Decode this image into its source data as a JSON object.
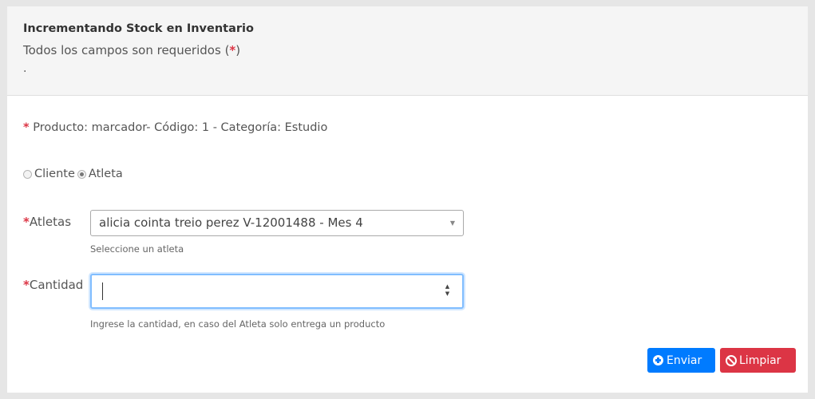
{
  "header": {
    "title": "Incrementando Stock en Inventario",
    "subtitle": "Todos los campos son requeridos",
    "subtitle_open": "(",
    "subtitle_star": "*",
    "subtitle_close": ")",
    "dot": "."
  },
  "product": {
    "star": "*",
    "text": "Producto: marcador- Código: 1 - Categoría: Estudio"
  },
  "recipient": {
    "options": [
      {
        "label": "Cliente",
        "checked": false
      },
      {
        "label": "Atleta",
        "checked": true
      }
    ]
  },
  "athletes": {
    "star": "*",
    "label": "Atletas",
    "selected": "alicia cointa treio perez V-12001488 - Mes 4",
    "help": "Seleccione un atleta"
  },
  "quantity": {
    "star": "*",
    "label": "Cantidad",
    "value": "",
    "help": "Ingrese la cantidad, en caso del Atleta solo entrega un producto"
  },
  "buttons": {
    "submit": "Enviar",
    "reset": "Limpiar"
  },
  "colors": {
    "primary": "#007bff",
    "danger": "#dc3545",
    "focus_border": "#80bdff"
  }
}
